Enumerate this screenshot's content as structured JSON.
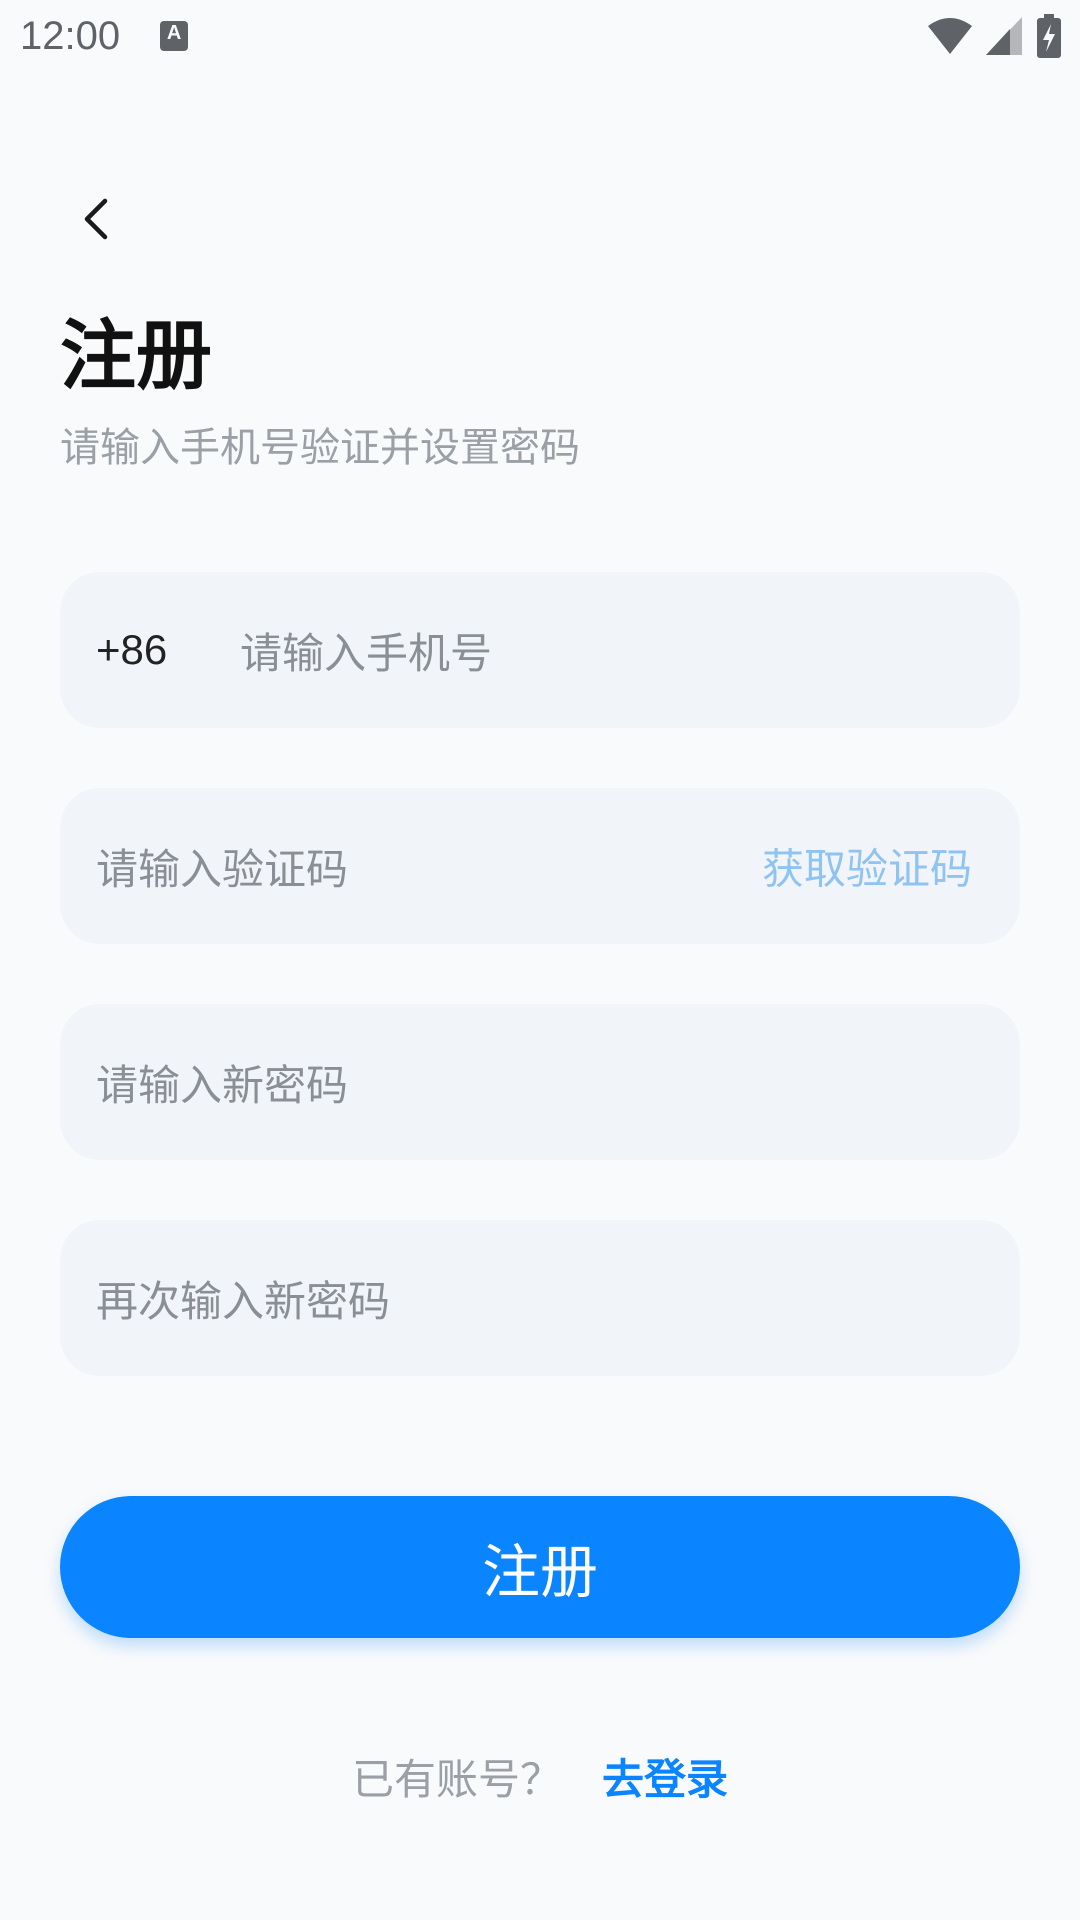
{
  "status_bar": {
    "time": "12:00",
    "notification_glyph": "A",
    "icons": [
      "wifi-icon",
      "cell-signal-icon",
      "battery-charging-icon"
    ]
  },
  "header": {
    "back_icon": "chevron-left-icon",
    "title": "注册",
    "subtitle": "请输入手机号验证并设置密码"
  },
  "form": {
    "phone": {
      "country_code": "+86",
      "placeholder": "请输入手机号",
      "value": ""
    },
    "code": {
      "placeholder": "请输入验证码",
      "value": "",
      "action_label": "获取验证码"
    },
    "password": {
      "placeholder": "请输入新密码",
      "value": ""
    },
    "password_confirm": {
      "placeholder": "再次输入新密码",
      "value": ""
    }
  },
  "submit": {
    "label": "注册"
  },
  "footer": {
    "prompt": "已有账号？",
    "link": "去登录"
  },
  "colors": {
    "primary": "#0a84ff",
    "action_disabled": "#8fc3f2",
    "field_bg": "#f1f5f9",
    "background": "#f9fafb"
  }
}
